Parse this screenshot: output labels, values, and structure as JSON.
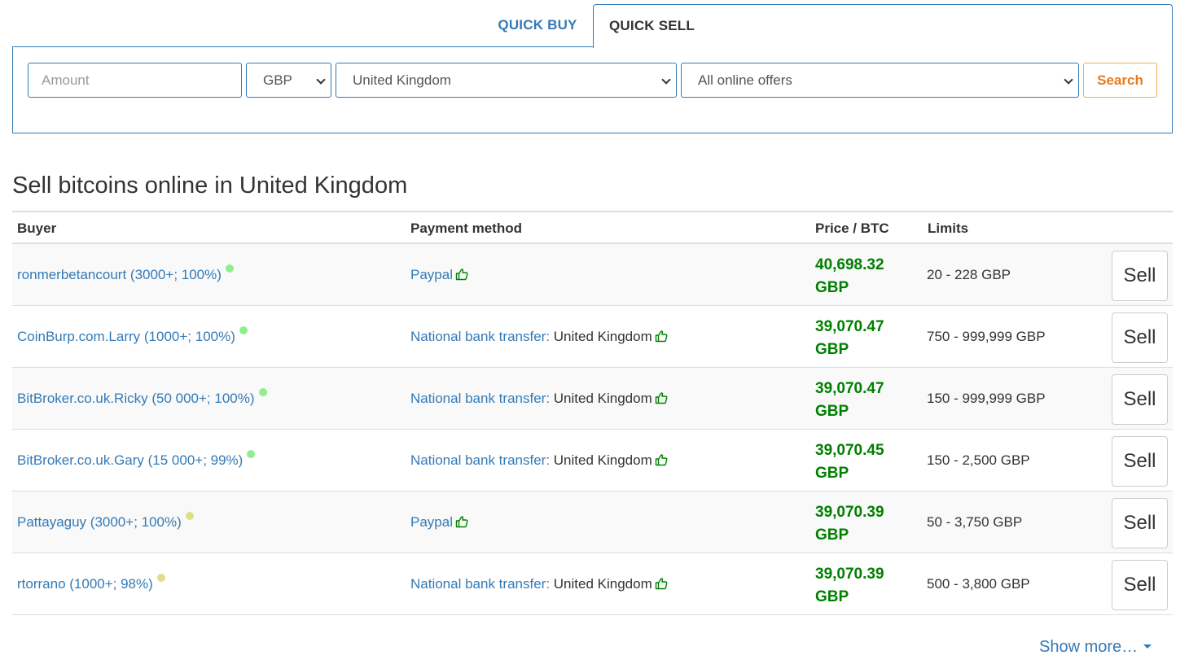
{
  "tabs": {
    "buy_label": "QUICK BUY",
    "sell_label": "QUICK SELL"
  },
  "search": {
    "amount_placeholder": "Amount",
    "currency": "GBP",
    "country": "United Kingdom",
    "offers": "All online offers",
    "search_label": "Search"
  },
  "page_title": "Sell bitcoins online in United Kingdom",
  "table": {
    "headers": {
      "buyer": "Buyer",
      "payment": "Payment method",
      "price": "Price / BTC",
      "limits": "Limits"
    },
    "rows": [
      {
        "buyer": "ronmerbetancourt (3000+; 100%)",
        "dot_color": "#90ee90",
        "payment": "Paypal",
        "region": "",
        "price": "40,698.32",
        "currency": "GBP",
        "limits": "20 - 228 GBP",
        "action": "Sell"
      },
      {
        "buyer": "CoinBurp.com.Larry (1000+; 100%)",
        "dot_color": "#90ee90",
        "payment": "National bank transfer:",
        "region": "United Kingdom",
        "price": "39,070.47",
        "currency": "GBP",
        "limits": "750 - 999,999 GBP",
        "action": "Sell"
      },
      {
        "buyer": "BitBroker.co.uk.Ricky (50 000+; 100%)",
        "dot_color": "#90ee90",
        "payment": "National bank transfer:",
        "region": "United Kingdom",
        "price": "39,070.47",
        "currency": "GBP",
        "limits": "150 - 999,999 GBP",
        "action": "Sell"
      },
      {
        "buyer": "BitBroker.co.uk.Gary (15 000+; 99%)",
        "dot_color": "#90ee90",
        "payment": "National bank transfer:",
        "region": "United Kingdom",
        "price": "39,070.45",
        "currency": "GBP",
        "limits": "150 - 2,500 GBP",
        "action": "Sell"
      },
      {
        "buyer": "Pattayaguy (3000+; 100%)",
        "dot_color": "#dede8a",
        "payment": "Paypal",
        "region": "",
        "price": "39,070.39",
        "currency": "GBP",
        "limits": "50 - 3,750 GBP",
        "action": "Sell"
      },
      {
        "buyer": "rtorrano (1000+; 98%)",
        "dot_color": "#dede8a",
        "payment": "National bank transfer:",
        "region": "United Kingdom",
        "price": "39,070.39",
        "currency": "GBP",
        "limits": "500 - 3,800 GBP",
        "action": "Sell"
      }
    ]
  },
  "show_more": "Show more…",
  "colors": {
    "link": "#337ab7",
    "price": "#008000",
    "search_accent": "#ec7a1c"
  },
  "icons": {
    "thumb": "thumbs-up-icon",
    "dropdown": "chevron-down-icon",
    "caret": "caret-down-icon"
  }
}
